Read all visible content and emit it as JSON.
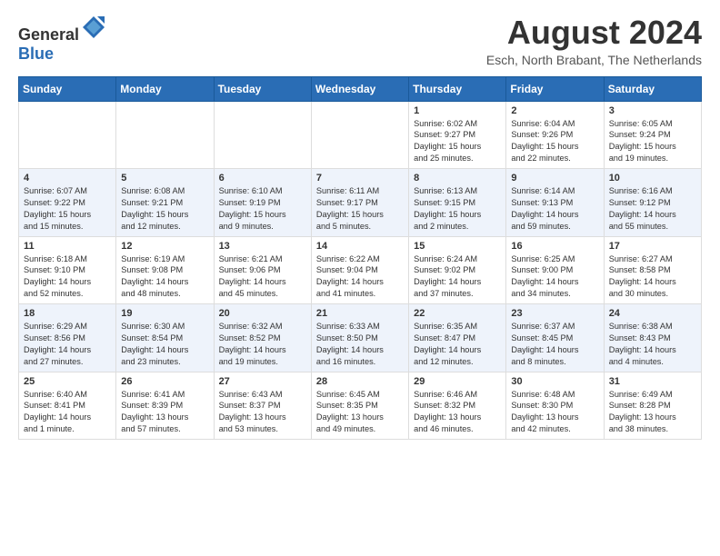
{
  "header": {
    "logo_general": "General",
    "logo_blue": "Blue",
    "month_year": "August 2024",
    "location": "Esch, North Brabant, The Netherlands"
  },
  "days_of_week": [
    "Sunday",
    "Monday",
    "Tuesday",
    "Wednesday",
    "Thursday",
    "Friday",
    "Saturday"
  ],
  "weeks": [
    [
      {
        "day": "",
        "content": ""
      },
      {
        "day": "",
        "content": ""
      },
      {
        "day": "",
        "content": ""
      },
      {
        "day": "",
        "content": ""
      },
      {
        "day": "1",
        "content": "Sunrise: 6:02 AM\nSunset: 9:27 PM\nDaylight: 15 hours\nand 25 minutes."
      },
      {
        "day": "2",
        "content": "Sunrise: 6:04 AM\nSunset: 9:26 PM\nDaylight: 15 hours\nand 22 minutes."
      },
      {
        "day": "3",
        "content": "Sunrise: 6:05 AM\nSunset: 9:24 PM\nDaylight: 15 hours\nand 19 minutes."
      }
    ],
    [
      {
        "day": "4",
        "content": "Sunrise: 6:07 AM\nSunset: 9:22 PM\nDaylight: 15 hours\nand 15 minutes."
      },
      {
        "day": "5",
        "content": "Sunrise: 6:08 AM\nSunset: 9:21 PM\nDaylight: 15 hours\nand 12 minutes."
      },
      {
        "day": "6",
        "content": "Sunrise: 6:10 AM\nSunset: 9:19 PM\nDaylight: 15 hours\nand 9 minutes."
      },
      {
        "day": "7",
        "content": "Sunrise: 6:11 AM\nSunset: 9:17 PM\nDaylight: 15 hours\nand 5 minutes."
      },
      {
        "day": "8",
        "content": "Sunrise: 6:13 AM\nSunset: 9:15 PM\nDaylight: 15 hours\nand 2 minutes."
      },
      {
        "day": "9",
        "content": "Sunrise: 6:14 AM\nSunset: 9:13 PM\nDaylight: 14 hours\nand 59 minutes."
      },
      {
        "day": "10",
        "content": "Sunrise: 6:16 AM\nSunset: 9:12 PM\nDaylight: 14 hours\nand 55 minutes."
      }
    ],
    [
      {
        "day": "11",
        "content": "Sunrise: 6:18 AM\nSunset: 9:10 PM\nDaylight: 14 hours\nand 52 minutes."
      },
      {
        "day": "12",
        "content": "Sunrise: 6:19 AM\nSunset: 9:08 PM\nDaylight: 14 hours\nand 48 minutes."
      },
      {
        "day": "13",
        "content": "Sunrise: 6:21 AM\nSunset: 9:06 PM\nDaylight: 14 hours\nand 45 minutes."
      },
      {
        "day": "14",
        "content": "Sunrise: 6:22 AM\nSunset: 9:04 PM\nDaylight: 14 hours\nand 41 minutes."
      },
      {
        "day": "15",
        "content": "Sunrise: 6:24 AM\nSunset: 9:02 PM\nDaylight: 14 hours\nand 37 minutes."
      },
      {
        "day": "16",
        "content": "Sunrise: 6:25 AM\nSunset: 9:00 PM\nDaylight: 14 hours\nand 34 minutes."
      },
      {
        "day": "17",
        "content": "Sunrise: 6:27 AM\nSunset: 8:58 PM\nDaylight: 14 hours\nand 30 minutes."
      }
    ],
    [
      {
        "day": "18",
        "content": "Sunrise: 6:29 AM\nSunset: 8:56 PM\nDaylight: 14 hours\nand 27 minutes."
      },
      {
        "day": "19",
        "content": "Sunrise: 6:30 AM\nSunset: 8:54 PM\nDaylight: 14 hours\nand 23 minutes."
      },
      {
        "day": "20",
        "content": "Sunrise: 6:32 AM\nSunset: 8:52 PM\nDaylight: 14 hours\nand 19 minutes."
      },
      {
        "day": "21",
        "content": "Sunrise: 6:33 AM\nSunset: 8:50 PM\nDaylight: 14 hours\nand 16 minutes."
      },
      {
        "day": "22",
        "content": "Sunrise: 6:35 AM\nSunset: 8:47 PM\nDaylight: 14 hours\nand 12 minutes."
      },
      {
        "day": "23",
        "content": "Sunrise: 6:37 AM\nSunset: 8:45 PM\nDaylight: 14 hours\nand 8 minutes."
      },
      {
        "day": "24",
        "content": "Sunrise: 6:38 AM\nSunset: 8:43 PM\nDaylight: 14 hours\nand 4 minutes."
      }
    ],
    [
      {
        "day": "25",
        "content": "Sunrise: 6:40 AM\nSunset: 8:41 PM\nDaylight: 14 hours\nand 1 minute."
      },
      {
        "day": "26",
        "content": "Sunrise: 6:41 AM\nSunset: 8:39 PM\nDaylight: 13 hours\nand 57 minutes."
      },
      {
        "day": "27",
        "content": "Sunrise: 6:43 AM\nSunset: 8:37 PM\nDaylight: 13 hours\nand 53 minutes."
      },
      {
        "day": "28",
        "content": "Sunrise: 6:45 AM\nSunset: 8:35 PM\nDaylight: 13 hours\nand 49 minutes."
      },
      {
        "day": "29",
        "content": "Sunrise: 6:46 AM\nSunset: 8:32 PM\nDaylight: 13 hours\nand 46 minutes."
      },
      {
        "day": "30",
        "content": "Sunrise: 6:48 AM\nSunset: 8:30 PM\nDaylight: 13 hours\nand 42 minutes."
      },
      {
        "day": "31",
        "content": "Sunrise: 6:49 AM\nSunset: 8:28 PM\nDaylight: 13 hours\nand 38 minutes."
      }
    ]
  ]
}
